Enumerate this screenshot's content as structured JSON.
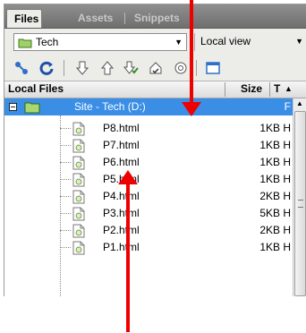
{
  "tabs": [
    {
      "label": "Files",
      "active": true
    },
    {
      "label": "Assets",
      "active": false
    },
    {
      "label": "Snippets",
      "active": false
    }
  ],
  "site_select": {
    "value": "Tech"
  },
  "view_select": {
    "value": "Local view"
  },
  "toolbar": {
    "icons": [
      "connect-icon",
      "refresh-icon",
      "get-files-icon",
      "put-files-icon",
      "check-out-icon",
      "check-in-icon",
      "sync-icon",
      "expand-icon"
    ]
  },
  "columns": {
    "name": "Local Files",
    "size": "Size",
    "type": "T"
  },
  "site_root": {
    "label": "Site - Tech (D:)",
    "type": "F"
  },
  "files": [
    {
      "name": "P8.html",
      "size": "1KB",
      "type": "H"
    },
    {
      "name": "P7.html",
      "size": "1KB",
      "type": "H"
    },
    {
      "name": "P6.html",
      "size": "1KB",
      "type": "H"
    },
    {
      "name": "P5.html",
      "size": "1KB",
      "type": "H"
    },
    {
      "name": "P4.html",
      "size": "2KB",
      "type": "H"
    },
    {
      "name": "P3.html",
      "size": "5KB",
      "type": "H"
    },
    {
      "name": "P2.html",
      "size": "2KB",
      "type": "H"
    },
    {
      "name": "P1.html",
      "size": "1KB",
      "type": "H"
    }
  ],
  "colors": {
    "selection": "#3a8ee6",
    "annotation_arrow": "#ee0000"
  }
}
